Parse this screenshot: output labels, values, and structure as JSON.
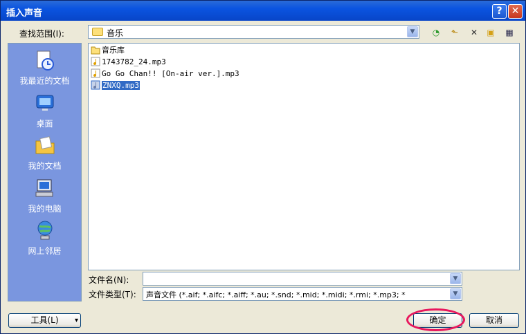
{
  "window": {
    "title": "插入声音",
    "help_glyph": "?",
    "close_glyph": "✕"
  },
  "lookin": {
    "label": "查找范围(I):",
    "value": "音乐"
  },
  "toolbar": {
    "back": "◔",
    "up": "⬑",
    "delete": "✕",
    "newfolder": "▣",
    "views": "▦"
  },
  "places": [
    {
      "label": "我最近的文档",
      "icon": "recent-documents-icon"
    },
    {
      "label": "桌面",
      "icon": "desktop-icon"
    },
    {
      "label": "我的文档",
      "icon": "my-documents-icon"
    },
    {
      "label": "我的电脑",
      "icon": "my-computer-icon"
    },
    {
      "label": "网上邻居",
      "icon": "network-icon"
    }
  ],
  "files": [
    {
      "name": "音乐库",
      "type": "folder",
      "selected": false
    },
    {
      "name": "1743782_24.mp3",
      "type": "audio",
      "selected": false
    },
    {
      "name": "Go Go Chan!! [On-air ver.].mp3",
      "type": "audio",
      "selected": false
    },
    {
      "name": "ZNXQ.mp3",
      "type": "audio",
      "selected": true
    }
  ],
  "filename": {
    "label": "文件名(N):",
    "value": ""
  },
  "filetype": {
    "label": "文件类型(T):",
    "value": "声音文件 (*.aif; *.aifc; *.aiff; *.au; *.snd; *.mid; *.midi; *.rmi; *.mp3; *"
  },
  "buttons": {
    "tools": "工具(L)",
    "tools_arrow": "▾",
    "ok": "确定",
    "cancel": "取消"
  }
}
